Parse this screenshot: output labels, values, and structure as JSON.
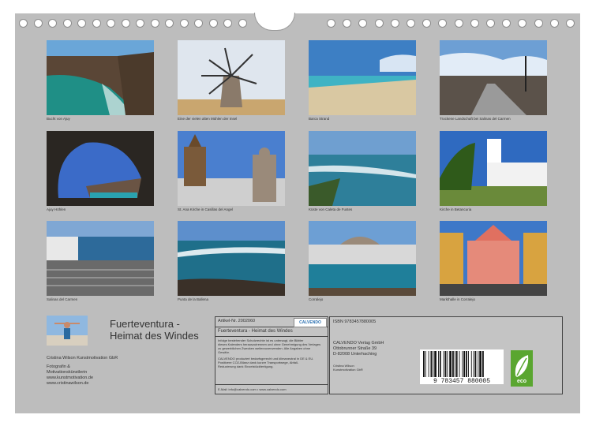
{
  "captions": [
    "Bucht von Ajuy",
    "Eine der vielen alten Mühlen der Insel",
    "Barca Strand",
    "Trockene Landschaft bei Salinas del Carmen",
    "Ajuy Höhlen",
    "St. Ana Kirche in Casillas del Angel",
    "Küste von Caleta de Fustes",
    "Kirche in Betancuria",
    "Salinas del Carmen",
    "Punta de la Ballena",
    "Corralejo",
    "Markthalle in Corralejo"
  ],
  "footer": {
    "title_line1": "Fuerteventura -",
    "title_line2": "Heimat des Windes",
    "author_line1": "Cristina Wilson Kunstmotivation GbR",
    "author_line2": "Fotografin &",
    "author_line3": "Motivationskünstlerin",
    "author_line4": "www.kunstmotivation.de",
    "author_line5": "www.cristinawilson.de"
  },
  "info": {
    "article": "Artikel-Nr. 2002060",
    "logo": "CALVENDO",
    "calendar_title": "Fuerteventura - Heimat des Windes",
    "legal1": "Infolge bestehender Schutzrechte ist es untersagt, die Blätter",
    "legal2": "dieses Kalenders herauszutrennen und ohne Genehmigung des Verlages",
    "legal3": "zu gewerblichen Zwecken weiterzuverwenden. Alle Angaben ohne",
    "legal4": "Gewähr.",
    "legal5": "CALVENDO produziert bedarfsgerecht und klimaneutral in DE & EU.",
    "legal6": "Positivere CO2-Bilanz dank kurzer Transportwege, Abfall-",
    "legal7": "Reduzierung dank Einzelstückfertigung.",
    "email": "E-Mail: info@calvendo.com • www.calvendo.com"
  },
  "publisher": {
    "isbn": "ISBN 9783457880005",
    "line1": "CALVENDO Verlag GmbH",
    "line2": "Ottobrunner Straße 39",
    "line3": "D-82008 Unterhaching",
    "author1": "Cristina Wilson",
    "author2": "Kunstmotivation GbR",
    "barcode": "9  783457  880005",
    "eco": "eco"
  }
}
